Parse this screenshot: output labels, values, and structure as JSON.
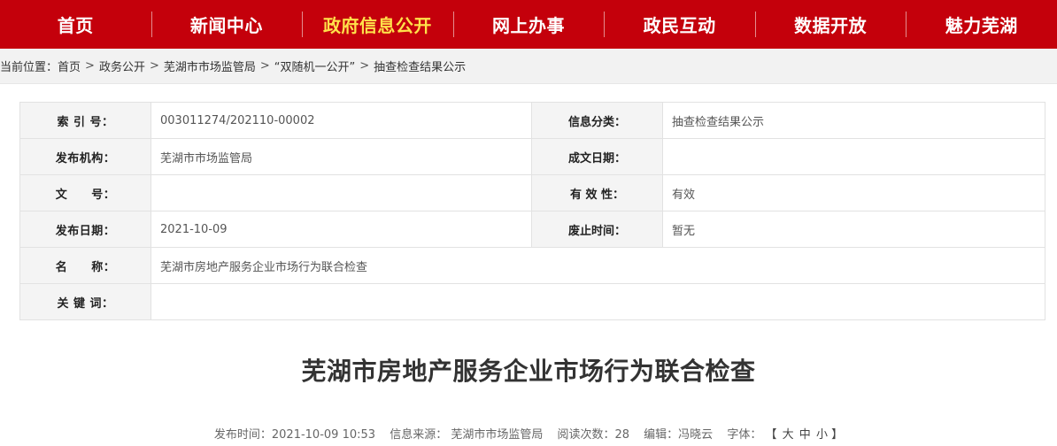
{
  "nav": {
    "items": [
      {
        "label": "首页"
      },
      {
        "label": "新闻中心"
      },
      {
        "label": "政府信息公开"
      },
      {
        "label": "网上办事"
      },
      {
        "label": "政民互动"
      },
      {
        "label": "数据开放"
      },
      {
        "label": "魅力芜湖"
      }
    ],
    "active_color": "#ffe14a",
    "bg_color": "#c4000b"
  },
  "breadcrumb": {
    "prefix": "当前位置：",
    "items": [
      "首页",
      "政务公开",
      "芜湖市市场监管局",
      "“双随机一公开”",
      "抽查检查结果公示"
    ],
    "separator": ">"
  },
  "info": {
    "index_label": "索 引 号：",
    "index_value": "003011274/202110-00002",
    "category_label": "信息分类：",
    "category_value": "抽查检查结果公示",
    "publisher_label": "发布机构：",
    "publisher_value": "芜湖市市场监管局",
    "written_date_label": "成文日期：",
    "written_date_value": "",
    "doc_no_label": "文　　号：",
    "doc_no_value": "",
    "validity_label": "有 效 性：",
    "validity_value": "有效",
    "publish_date_label": "发布日期：",
    "publish_date_value": "2021-10-09",
    "expiry_label": "废止时间：",
    "expiry_value": "暂无",
    "name_label": "名　　称：",
    "name_value": "芜湖市房地产服务企业市场行为联合检查",
    "keywords_label": "关 键 词：",
    "keywords_value": ""
  },
  "article": {
    "title": "芜湖市房地产服务企业市场行为联合检查",
    "publish_time": "发布时间：2021-10-09 10:53",
    "source": "信息来源：  芜湖市市场监管局",
    "views": "阅读次数：28",
    "editor": "编辑：冯晓云",
    "font_label": "字体：",
    "font_open": "【",
    "font_large": "大",
    "font_medium": "中",
    "font_small": "小",
    "font_close": "】"
  }
}
